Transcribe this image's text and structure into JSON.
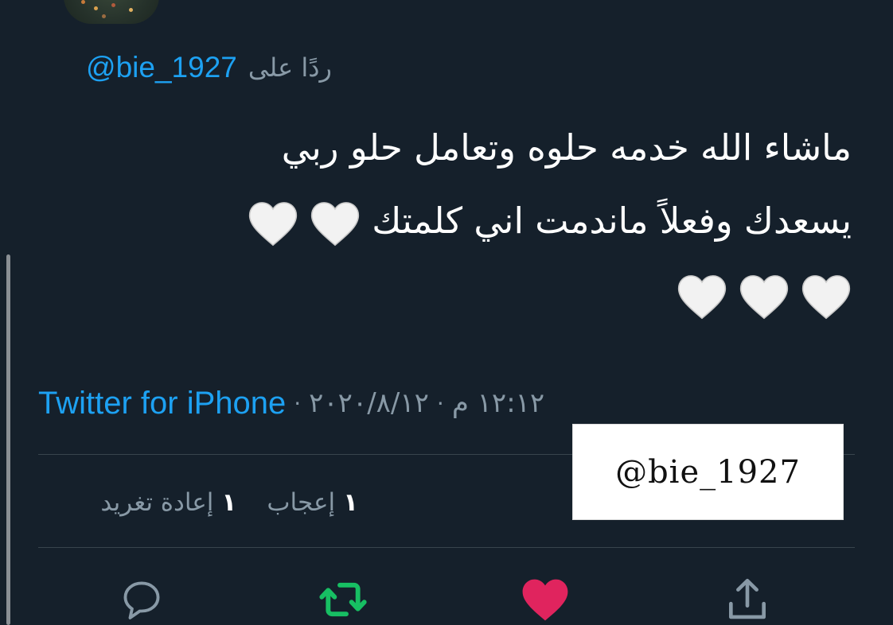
{
  "tweet": {
    "reply_prefix": "ردًا على",
    "reply_handle": "@bie_1927",
    "text_lines": [
      "ماشاء الله خدمه حلوه وتعامل حلو ربي",
      "يسعدك وفعلاً ماندمت اني كلمتك"
    ],
    "hearts": "🤍🤍🤍🤍🤍",
    "time": "١٢:١٢ م",
    "date": "٢٠٢٠/٨/١٢",
    "separator": "·",
    "source": "Twitter for iPhone"
  },
  "stats": {
    "retweets_count": "١",
    "retweets_label": "إعادة تغريد",
    "likes_count": "١",
    "likes_label": "إعجاب"
  },
  "watermark": {
    "text": "@bie_1927"
  },
  "actions": {
    "icons": [
      "reply-icon",
      "retweet-icon",
      "like-icon",
      "share-icon"
    ],
    "retweet_color": "#17bf63",
    "like_color": "#e0245e",
    "neutral_color": "#8899a6",
    "link_color": "#1da1f2"
  }
}
